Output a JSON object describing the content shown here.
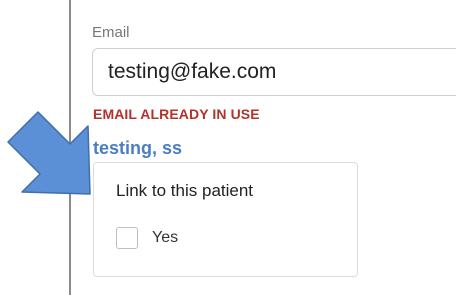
{
  "email": {
    "label": "Email",
    "value": "testing@fake.com",
    "error": "EMAIL ALREADY IN USE"
  },
  "match": {
    "patient_name": "testing, ss"
  },
  "link_panel": {
    "title": "Link to this patient",
    "checkbox_label": "Yes",
    "checked": false
  },
  "annotation": {
    "arrow_color": "#5b8fd6",
    "arrow_icon": "arrow-down-right-icon"
  },
  "colors": {
    "error": "#b5312b",
    "link": "#4a7ec4"
  }
}
